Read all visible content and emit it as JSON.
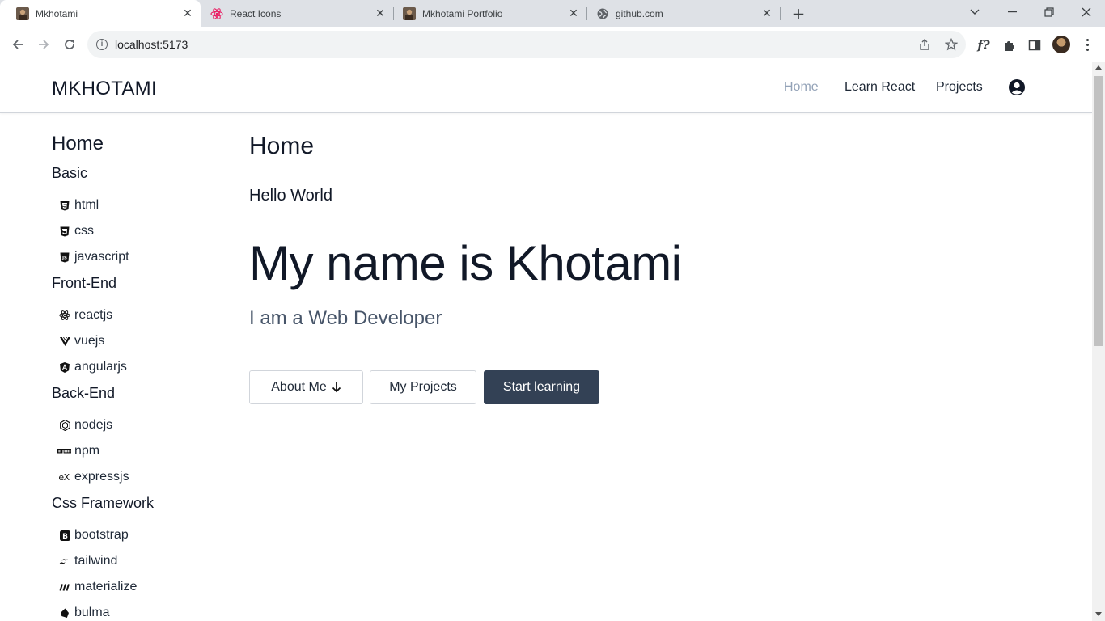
{
  "browser": {
    "tabs": [
      {
        "title": "Mkhotami",
        "active": true
      },
      {
        "title": "React Icons",
        "active": false
      },
      {
        "title": "Mkhotami Portfolio",
        "active": false
      },
      {
        "title": "github.com",
        "active": false
      }
    ],
    "url": "localhost:5173",
    "icons": [
      "back-icon",
      "forward-icon",
      "reload-icon",
      "info-icon",
      "share-icon",
      "star-icon",
      "font-ext-icon",
      "extensions-icon",
      "side-panel-icon",
      "profile-avatar",
      "menu-icon"
    ]
  },
  "site": {
    "brand": "MKHOTAMI",
    "nav": [
      {
        "label": "Home",
        "active": true
      },
      {
        "label": "Learn React",
        "active": false
      },
      {
        "label": "Projects",
        "active": false
      }
    ],
    "active_color": "#94a3b8"
  },
  "sidebar": {
    "home": "Home",
    "groups": [
      {
        "title": "Basic",
        "items": [
          {
            "label": "html",
            "icon": "html5-icon"
          },
          {
            "label": "css",
            "icon": "css3-icon"
          },
          {
            "label": "javascript",
            "icon": "js-icon"
          }
        ]
      },
      {
        "title": "Front-End",
        "items": [
          {
            "label": "reactjs",
            "icon": "react-icon"
          },
          {
            "label": "vuejs",
            "icon": "vue-icon"
          },
          {
            "label": "angularjs",
            "icon": "angular-icon"
          }
        ]
      },
      {
        "title": "Back-End",
        "items": [
          {
            "label": "nodejs",
            "icon": "node-icon"
          },
          {
            "label": "npm",
            "icon": "npm-icon"
          },
          {
            "label": "expressjs",
            "icon": "express-icon"
          }
        ]
      },
      {
        "title": "Css Framework",
        "items": [
          {
            "label": "bootstrap",
            "icon": "bootstrap-icon"
          },
          {
            "label": "tailwind",
            "icon": "tailwind-icon"
          },
          {
            "label": "materialize",
            "icon": "materialize-icon"
          },
          {
            "label": "bulma",
            "icon": "bulma-icon"
          }
        ]
      }
    ]
  },
  "main": {
    "title": "Home",
    "greeting": "Hello World",
    "headline": "My name is Khotami",
    "subtitle": "I am a Web Developer",
    "buttons": {
      "about": "About Me",
      "projects": "My Projects",
      "start": "Start learning"
    },
    "dark_button_color": "#334155"
  }
}
